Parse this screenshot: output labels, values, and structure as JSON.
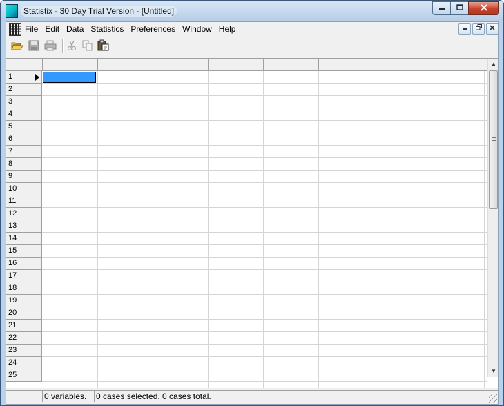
{
  "window": {
    "title": "Statistix - 30 Day Trial Version - [Untitled]",
    "caption_buttons": [
      "minimize-icon",
      "maximize-icon",
      "close-icon"
    ]
  },
  "menubar": {
    "items": [
      "File",
      "Edit",
      "Data",
      "Statistics",
      "Preferences",
      "Window",
      "Help"
    ],
    "mdi_buttons": [
      "minimize-icon",
      "restore-icon",
      "close-icon"
    ]
  },
  "toolbar": {
    "buttons": [
      {
        "name": "open-icon",
        "enabled": true
      },
      {
        "name": "save-icon",
        "enabled": false
      },
      {
        "name": "print-icon",
        "enabled": false
      },
      {
        "name": "cut-icon",
        "enabled": false
      },
      {
        "name": "copy-icon",
        "enabled": false
      },
      {
        "name": "paste-icon",
        "enabled": true
      }
    ]
  },
  "grid": {
    "column_headers": [
      "",
      "",
      "",
      "",
      "",
      "",
      "",
      ""
    ],
    "rows": [
      "1",
      "2",
      "3",
      "4",
      "5",
      "6",
      "7",
      "8",
      "9",
      "10",
      "11",
      "12",
      "13",
      "14",
      "15",
      "16",
      "17",
      "18",
      "19",
      "20",
      "21",
      "22",
      "23",
      "24",
      "25"
    ],
    "active_row": "1",
    "selection_color": "#3399ff"
  },
  "statusbar": {
    "variables": "0 variables.",
    "cases": "0 cases selected. 0 cases total."
  }
}
